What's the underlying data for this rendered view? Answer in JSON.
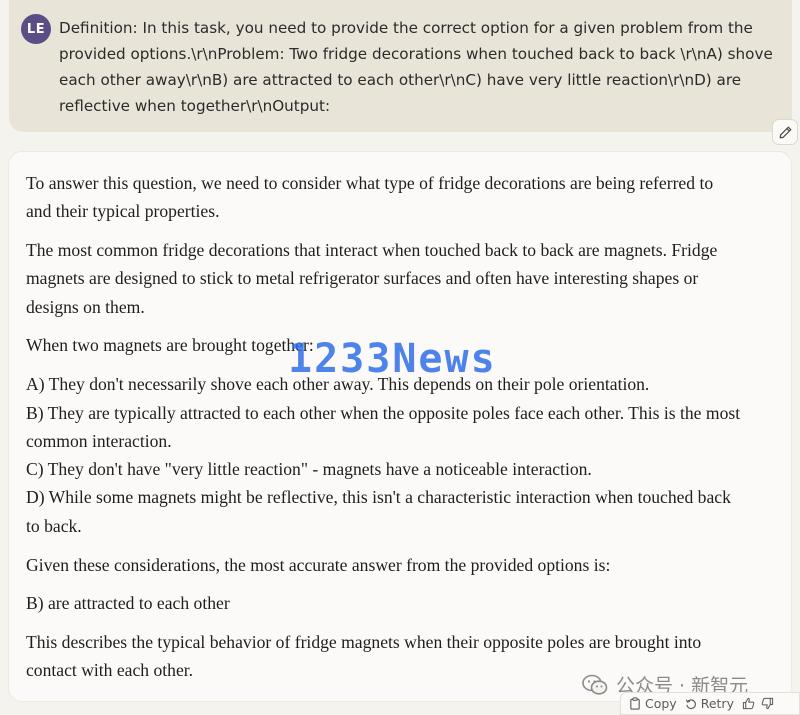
{
  "user_message": {
    "avatar_initials": "LE",
    "text": "Definition: In this task, you need to provide the correct option for a given problem from the provided options.\\r\\nProblem: Two fridge decorations when touched back to back \\r\\nA) shove each other away\\r\\nB) are attracted to each other\\r\\nC) have very little reaction\\r\\nD) are reflective when together\\r\\nOutput:"
  },
  "assistant_message": {
    "paragraphs": [
      "To answer this question, we need to consider what type of fridge decorations are being referred to and their typical properties.",
      "The most common fridge decorations that interact when touched back to back are magnets. Fridge magnets are designed to stick to metal refrigerator surfaces and often have interesting shapes or designs on them.",
      "When two magnets are brought together:"
    ],
    "options": [
      "A) They don't necessarily shove each other away. This depends on their pole orientation.",
      "B) They are typically attracted to each other when the opposite poles face each other. This is the most common interaction.",
      "C) They don't have \"very little reaction\" - magnets have a noticeable interaction.",
      "D) While some magnets might be reflective, this isn't a characteristic interaction when touched back to back."
    ],
    "conclusion": "Given these considerations, the most accurate answer from the provided options is:",
    "answer": "B) are attracted to each other",
    "closing": "This describes the typical behavior of fridge magnets when their opposite poles are brought into contact with each other."
  },
  "watermark": {
    "text": "1233News",
    "wechat_label": "公众号 · 新智元"
  },
  "actions": {
    "copy_label": "Copy",
    "retry_label": "Retry"
  },
  "icons": {
    "edit": "pencil-icon",
    "copy": "clipboard-icon",
    "retry": "retry-icon",
    "thumbs_up": "thumbs-up-icon",
    "thumbs_down": "thumbs-down-icon"
  },
  "colors": {
    "avatar_bg": "#5b4e86",
    "user_bubble": "#e8e4d8",
    "assistant_bubble": "#fbfaf8",
    "watermark": "#2f6fe8"
  }
}
